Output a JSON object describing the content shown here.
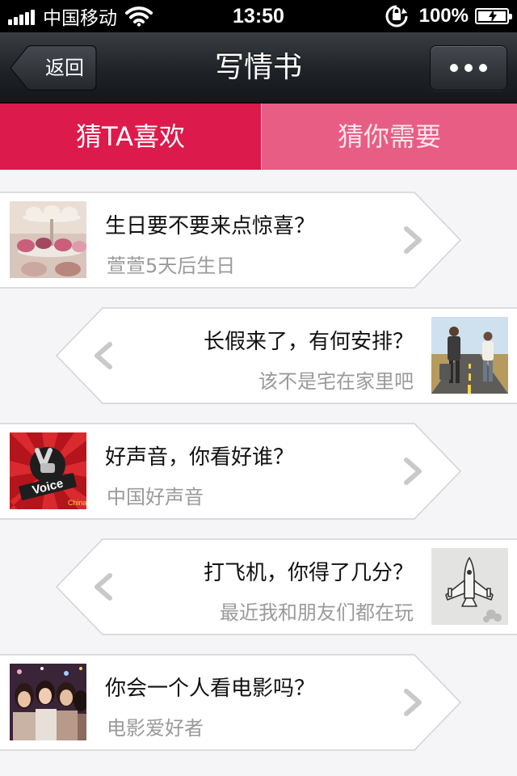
{
  "status_bar": {
    "carrier": "中国移动",
    "time": "13:50",
    "battery": "100%",
    "battery_level": 1.0
  },
  "nav": {
    "back_label": "返回",
    "title": "写情书",
    "more_icon": "ellipsis-icon"
  },
  "tabs": [
    {
      "label": "猜TA喜欢",
      "active": true
    },
    {
      "label": "猜你需要",
      "active": false
    }
  ],
  "colors": {
    "tab_active": "#dc1a4c",
    "tab_inactive": "#e85d84",
    "navbar": "#1f2226"
  },
  "cards": [
    {
      "title": "生日要不要来点惊喜？",
      "subtitle": "萱萱5天后生日",
      "image": "cupcakes-image",
      "direction": "right"
    },
    {
      "title": "长假来了，有何安排？",
      "subtitle": "该不是宅在家里吧",
      "image": "travel-couple-image",
      "direction": "left"
    },
    {
      "title": "好声音，你看好谁？",
      "subtitle": "中国好声音",
      "image": "voice-of-china-logo-image",
      "direction": "right"
    },
    {
      "title": "打飞机，你得了几分？",
      "subtitle": "最近我和朋友们都在玩",
      "image": "plane-game-image",
      "direction": "left"
    },
    {
      "title": "你会一个人看电影吗？",
      "subtitle": "电影爱好者",
      "image": "group-friends-image",
      "direction": "right"
    }
  ]
}
